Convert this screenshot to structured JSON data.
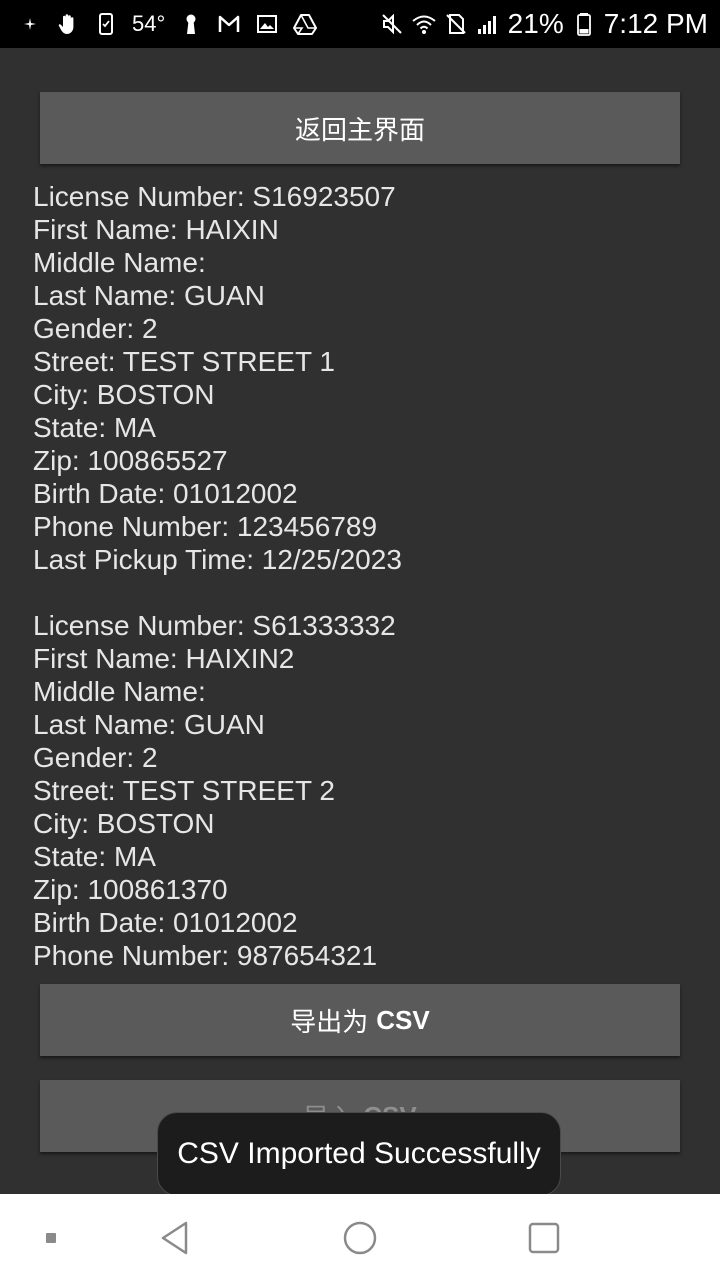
{
  "status_bar": {
    "temperature": "54°",
    "battery_percent": "21%",
    "time": "7:12 PM",
    "icons": [
      "notification-dot-icon",
      "hand-icon",
      "phone-icon",
      "temperature",
      "keyhole-icon",
      "gmail-icon",
      "gallery-icon",
      "drive-icon",
      "mute-icon",
      "wifi-icon",
      "no-sim-icon",
      "signal-icon",
      "battery-icon"
    ]
  },
  "buttons": {
    "home_label": "返回主界面",
    "export_label_cn": "导出为",
    "export_label_en": "CSV",
    "import_label_cn": "导入",
    "import_label_en": "CSV"
  },
  "records": [
    {
      "lines": [
        "License Number: S16923507",
        "First Name: HAIXIN",
        "Middle Name:",
        "Last Name: GUAN",
        "Gender: 2",
        "Street: TEST STREET 1",
        "City: BOSTON",
        "State: MA",
        "Zip: 100865527",
        "Birth Date: 01012002",
        "Phone Number: 123456789",
        "Last Pickup Time: 12/25/2023"
      ]
    },
    {
      "lines": [
        "License Number: S61333332",
        "First Name: HAIXIN2",
        "Middle Name:",
        "Last Name: GUAN",
        "Gender: 2",
        "Street: TEST STREET 2",
        "City: BOSTON",
        "State: MA",
        "Zip: 100861370",
        "Birth Date: 01012002",
        "Phone Number: 987654321"
      ]
    }
  ],
  "toast": {
    "message": "CSV Imported Successfully"
  },
  "nav_bar": {
    "icons": [
      "recent-dot-icon",
      "back-icon",
      "home-icon",
      "overview-icon"
    ]
  },
  "colors": {
    "background": "#303030",
    "button": "#5a5a5b",
    "text": "#e6e6e6",
    "toast_bg": "#1c1c1c",
    "nav_bar": "#ffffff"
  }
}
